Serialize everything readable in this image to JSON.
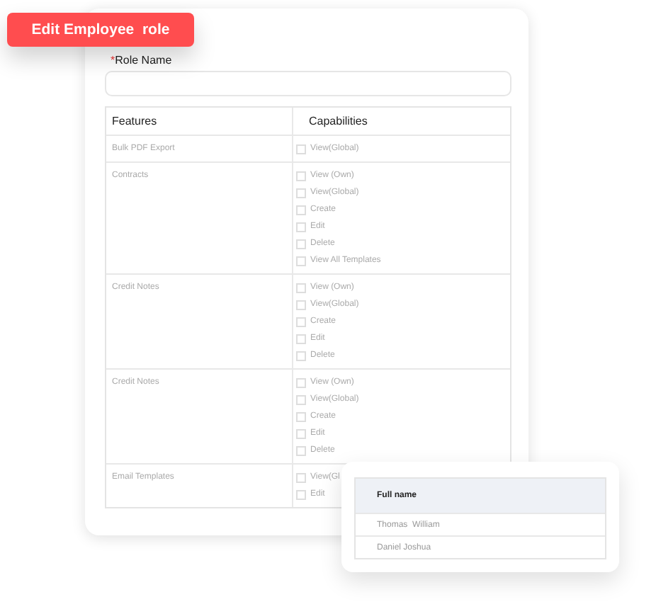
{
  "badge": "Edit Employee  role",
  "role_field": {
    "label": "Role Name",
    "required_mark": "*"
  },
  "table": {
    "columns": [
      "Features",
      "Capabilities"
    ],
    "rows": [
      {
        "feature": "Bulk PDF Export",
        "capabilities": [
          {
            "label": "View(Global)",
            "checked": false
          }
        ]
      },
      {
        "feature": "Contracts",
        "capabilities": [
          {
            "label": "View (Own)",
            "checked": false
          },
          {
            "label": "View(Global)",
            "checked": false
          },
          {
            "label": "Create",
            "checked": false
          },
          {
            "label": "Edit",
            "checked": false
          },
          {
            "label": "Delete",
            "checked": false
          },
          {
            "label": "View All Templates",
            "checked": false
          }
        ]
      },
      {
        "feature": "Credit Notes",
        "capabilities": [
          {
            "label": "View (Own)",
            "checked": false
          },
          {
            "label": "View(Global)",
            "checked": false
          },
          {
            "label": "Create",
            "checked": false
          },
          {
            "label": "Edit",
            "checked": false
          },
          {
            "label": "Delete",
            "checked": false
          }
        ]
      },
      {
        "feature": "Credit Notes",
        "capabilities": [
          {
            "label": "View (Own)",
            "checked": false
          },
          {
            "label": "View(Global)",
            "checked": false
          },
          {
            "label": "Create",
            "checked": false
          },
          {
            "label": "Edit",
            "checked": false
          },
          {
            "label": "Delete",
            "checked": false
          }
        ]
      },
      {
        "feature": "Email Templates",
        "capabilities": [
          {
            "label": "View(Gl",
            "checked": false
          },
          {
            "label": "Edit",
            "checked": false
          }
        ]
      }
    ]
  },
  "names_card": {
    "column": "Full name",
    "rows": [
      "Thomas  William",
      "Daniel Joshua"
    ]
  }
}
